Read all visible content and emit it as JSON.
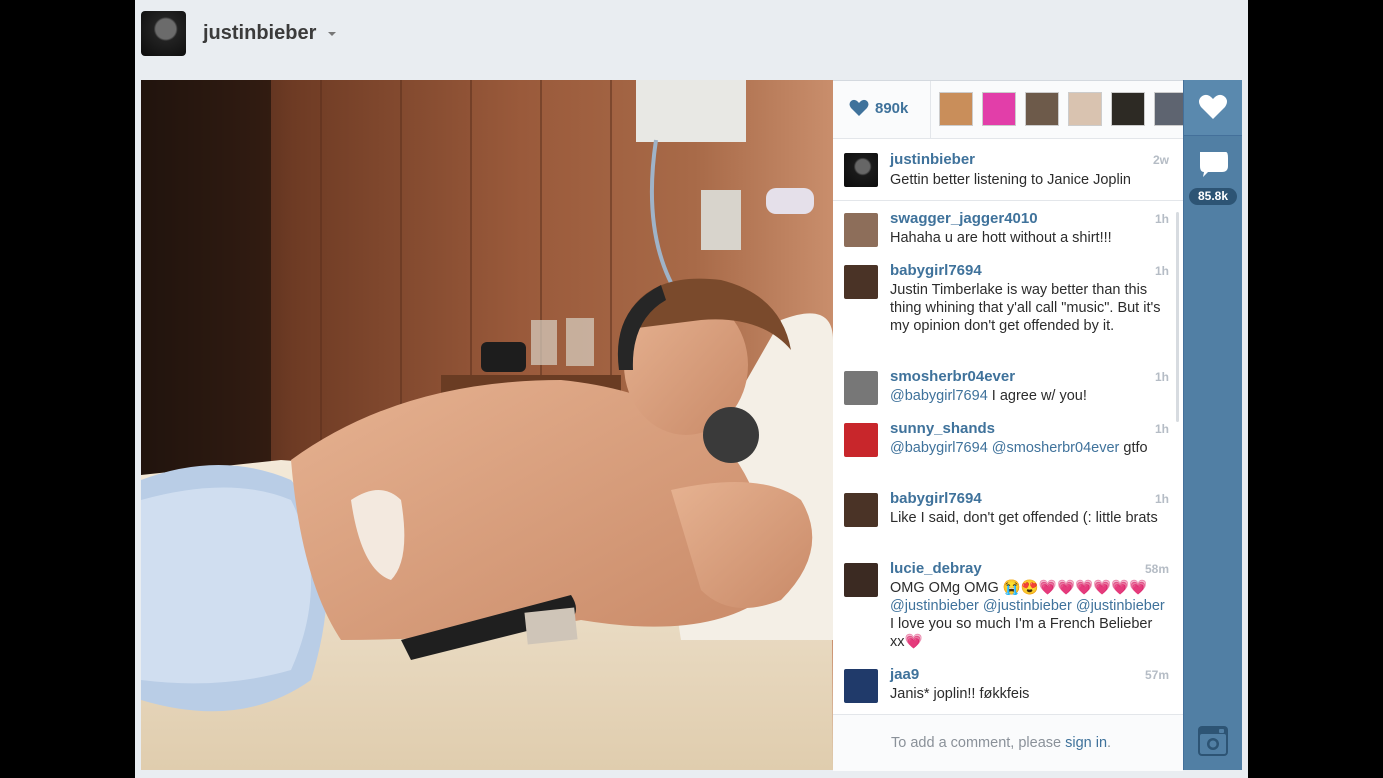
{
  "header": {
    "username": "justinbieber"
  },
  "likes": {
    "count": "890k",
    "icon": "heart-icon"
  },
  "caption": {
    "user": "justinbieber",
    "time": "2w",
    "text": "Gettin better listening to Janice Joplin"
  },
  "comments": [
    {
      "user": "swagger_jagger4010",
      "time": "1h",
      "parts": [
        {
          "t": "Hahaha u are hott without a shirt!!!"
        }
      ]
    },
    {
      "user": "babygirl7694",
      "time": "1h",
      "parts": [
        {
          "t": "Justin Timberlake is way better than this thing whining that y'all call \"music\". But it's my opinion don't get offended by it."
        }
      ]
    },
    {
      "user": "smosherbr04ever",
      "time": "1h",
      "parts": [
        {
          "t": "@babygirl7694",
          "m": true
        },
        {
          "t": " I agree w/ you!"
        }
      ]
    },
    {
      "user": "sunny_shands",
      "time": "1h",
      "parts": [
        {
          "t": "@babygirl7694",
          "m": true
        },
        {
          "t": " "
        },
        {
          "t": "@smosherbr04ever",
          "m": true
        },
        {
          "t": " gtfo"
        }
      ]
    },
    {
      "user": "babygirl7694",
      "time": "1h",
      "parts": [
        {
          "t": "Like I said, don't get offended (: little brats"
        }
      ]
    },
    {
      "user": "lucie_debray",
      "time": "58m",
      "parts": [
        {
          "t": "OMG OMg OMG "
        },
        {
          "t": "😭😍💗💗💗💗💗💗 "
        },
        {
          "t": "@justinbieber",
          "m": true
        },
        {
          "t": " "
        },
        {
          "t": "@justinbieber",
          "m": true
        },
        {
          "t": " "
        },
        {
          "t": "@justinbieber",
          "m": true
        },
        {
          "t": " I love you so much I'm a French Belieber xx💗"
        }
      ]
    },
    {
      "user": "jaa9",
      "time": "57m",
      "parts": [
        {
          "t": "Janis* joplin!! føkkfeis"
        }
      ]
    }
  ],
  "signin": {
    "prefix": "To add a comment, please ",
    "link": "sign in",
    "suffix": "."
  },
  "rail": {
    "comments_count": "85.8k"
  },
  "colors": {
    "link": "#3f729b",
    "rail": "#517fa4"
  }
}
